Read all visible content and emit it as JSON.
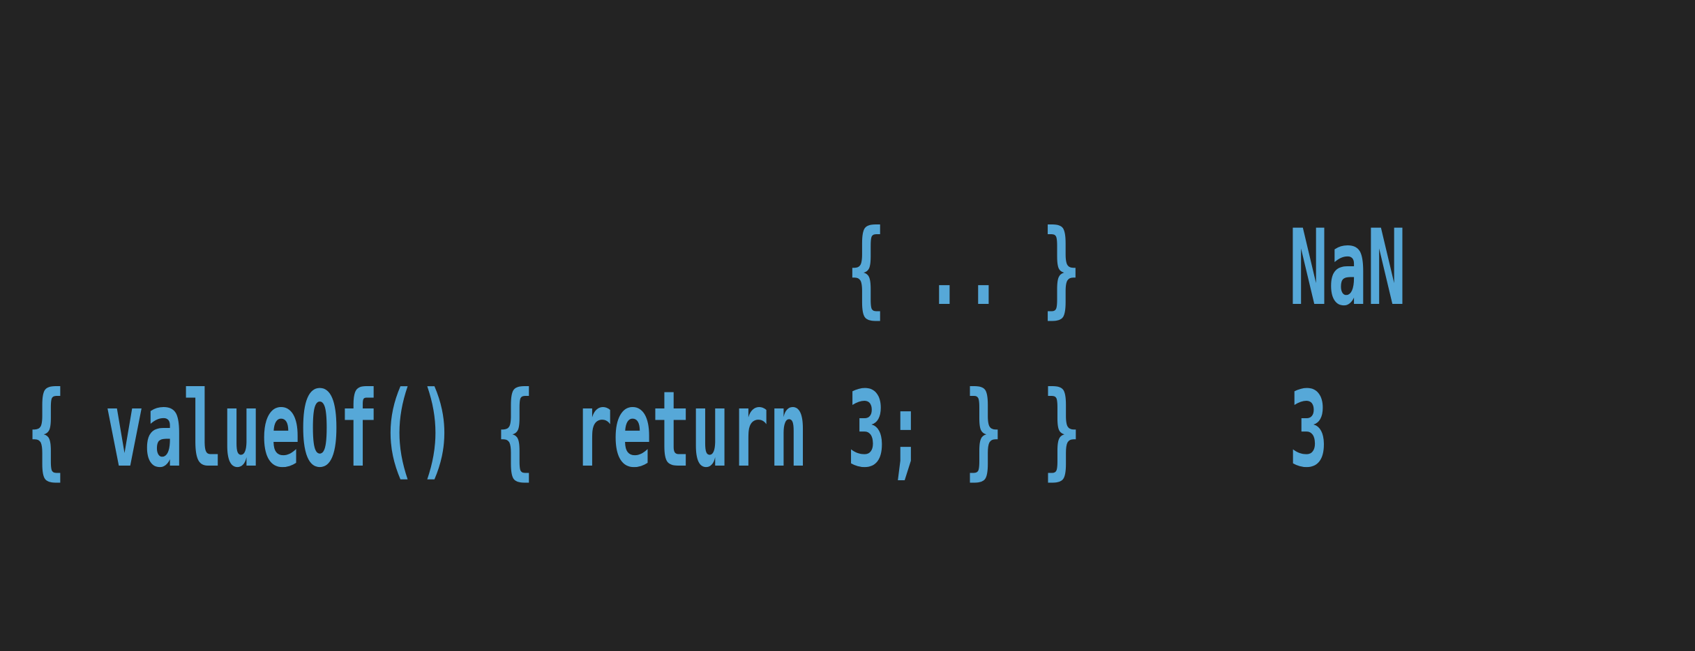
{
  "rows": [
    {
      "expression": "{ .. }",
      "result": "NaN"
    },
    {
      "expression": "{ valueOf() { return 3; } }",
      "result": "3"
    }
  ],
  "colors": {
    "background": "#232323",
    "text": "#56a8d8"
  }
}
